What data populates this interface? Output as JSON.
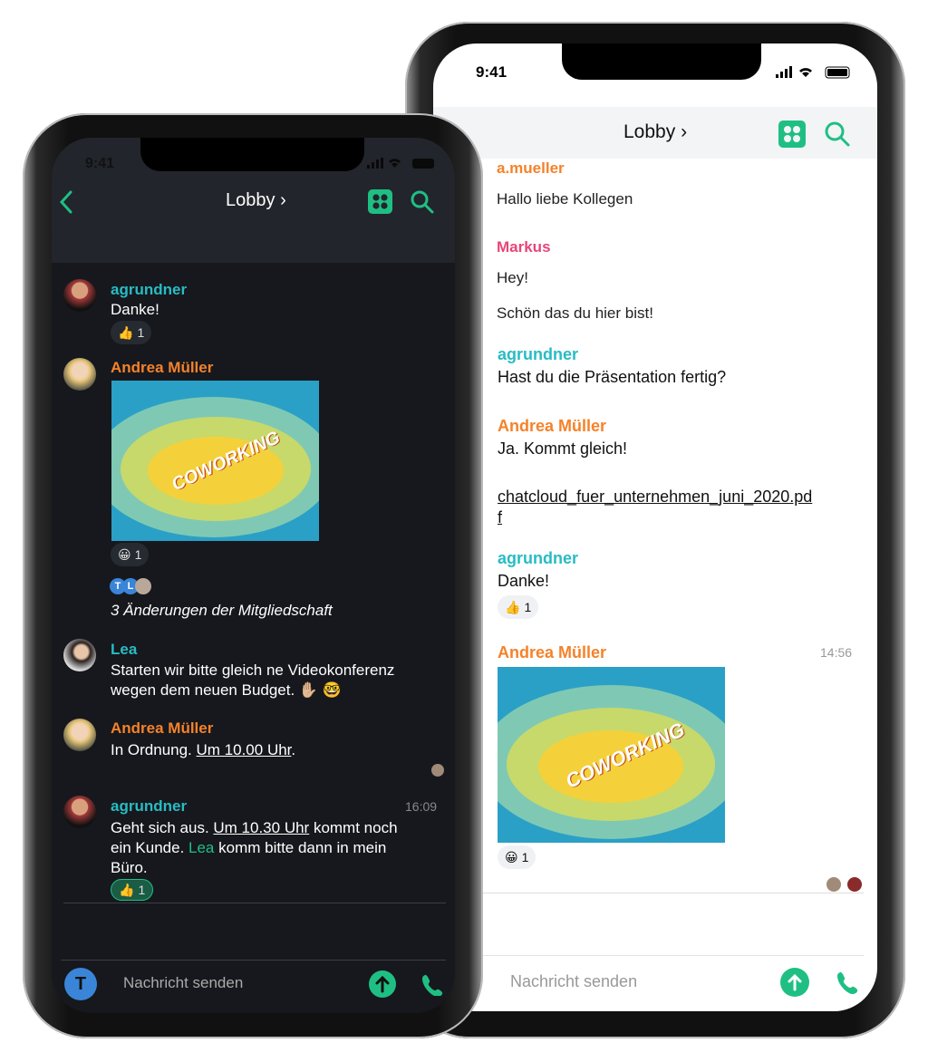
{
  "colors": {
    "accent": "#1fbf84",
    "teal_user": "#28bcc4",
    "orange_user": "#f5822a",
    "pink_user": "#e8457a",
    "avatar_blue": "#3a85d8"
  },
  "back_phone": {
    "status_time": "9:41",
    "header": {
      "title": "Lobby",
      "chevron": "›",
      "icons": [
        "grid-icon",
        "search-icon"
      ]
    },
    "messages": [
      {
        "author": "a.mueller",
        "lines": [
          "Hallo liebe Kollegen"
        ]
      },
      {
        "author": "Markus",
        "lines": [
          "Hey!",
          "Schön das du hier bist!"
        ]
      },
      {
        "author": "agrundner",
        "lines": [
          "Hast du die Präsentation fertig?"
        ]
      },
      {
        "author": "Andrea Müller",
        "lines": [
          "Ja. Kommt gleich!"
        ],
        "attachment": [
          "chatcloud_fuer_unternehmen_juni_2020.pd",
          "f"
        ]
      },
      {
        "author": "agrundner",
        "lines": [
          "Danke!"
        ],
        "reaction": {
          "emoji": "👍",
          "count": "1"
        }
      },
      {
        "author": "Andrea Müller",
        "time": "14:56",
        "image_label": "COWORKING",
        "reaction": {
          "emoji": "😀",
          "count": "1"
        }
      }
    ],
    "input_placeholder": "Nachricht senden"
  },
  "front_phone": {
    "status_time": "9:41",
    "header": {
      "title": "Lobby",
      "chevron": "›",
      "icons": [
        "back-icon",
        "grid-icon",
        "search-icon"
      ]
    },
    "messages": [
      {
        "author": "agrundner",
        "text": "Danke!",
        "reaction": {
          "emoji": "👍",
          "count": "1"
        }
      },
      {
        "author": "Andrea Müller",
        "image_label": "COWORKING",
        "reaction": {
          "emoji": "😀",
          "count": "1"
        }
      },
      {
        "membership": "3 Änderungen der Mitgliedschaft",
        "avatars": [
          "T",
          "L"
        ]
      },
      {
        "author": "Lea",
        "lines": [
          "Starten wir bitte gleich ne Videokonferenz",
          "wegen dem neuen Budget. ✋🏼 🤓"
        ]
      },
      {
        "author": "Andrea Müller",
        "prefix": "In Ordnung. ",
        "link": "Um 10.00 Uhr",
        "suffix": "."
      },
      {
        "author": "agrundner",
        "time": "16:09",
        "p1": "Geht sich aus. ",
        "link": "Um 10.30 Uhr",
        "p2": " kommt noch",
        "p3": "ein Kunde. ",
        "mention": "Lea",
        "p4": " komm bitte dann in mein",
        "p5": "Büro.",
        "reaction": {
          "emoji": "👍",
          "count": "1"
        }
      }
    ],
    "own_avatar": "T",
    "input_placeholder": "Nachricht senden"
  }
}
